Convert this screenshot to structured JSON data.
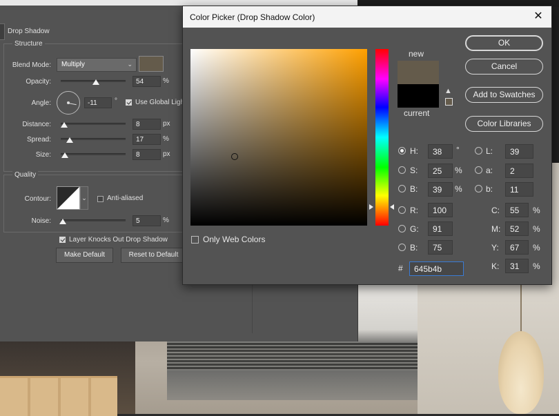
{
  "layer_style": {
    "section_title": "Drop Shadow",
    "structure": {
      "group_label": "Structure",
      "blend_mode_label": "Blend Mode:",
      "blend_mode_value": "Multiply",
      "shadow_color": "#645b4b",
      "opacity_label": "Opacity:",
      "opacity_value": "54",
      "opacity_fraction": 0.54,
      "opacity_unit": "%",
      "angle_label": "Angle:",
      "angle_value": "-11",
      "angle_unit": "°",
      "use_global_light_label": "Use Global Ligh",
      "use_global_light_checked": true,
      "distance_label": "Distance:",
      "distance_value": "8",
      "distance_unit": "px",
      "spread_label": "Spread:",
      "spread_value": "17",
      "spread_unit": "%",
      "size_label": "Size:",
      "size_value": "8",
      "size_unit": "px"
    },
    "quality": {
      "group_label": "Quality",
      "contour_label": "Contour:",
      "anti_aliased_label": "Anti-aliased",
      "anti_aliased_checked": false,
      "noise_label": "Noise:",
      "noise_value": "5",
      "noise_unit": "%"
    },
    "layer_knocks_out_label": "Layer Knocks Out Drop Shadow",
    "layer_knocks_out_checked": true,
    "make_default_label": "Make Default",
    "reset_default_label": "Reset to Default"
  },
  "color_picker": {
    "title": "Color Picker (Drop Shadow Color)",
    "new_label": "new",
    "current_label": "current",
    "new_color": "#645b4b",
    "current_color": "#000000",
    "buttons": {
      "ok": "OK",
      "cancel": "Cancel",
      "add_to_swatches": "Add to Swatches",
      "color_libraries": "Color Libraries"
    },
    "only_web_colors_label": "Only Web Colors",
    "hsb": [
      {
        "label": "H:",
        "value": "38",
        "unit": "°",
        "selected": true
      },
      {
        "label": "S:",
        "value": "25",
        "unit": "%",
        "selected": false
      },
      {
        "label": "B:",
        "value": "39",
        "unit": "%",
        "selected": false
      }
    ],
    "rgb": [
      {
        "label": "R:",
        "value": "100"
      },
      {
        "label": "G:",
        "value": "91"
      },
      {
        "label": "B:",
        "value": "75"
      }
    ],
    "lab": [
      {
        "label": "L:",
        "value": "39"
      },
      {
        "label": "a:",
        "value": "2"
      },
      {
        "label": "b:",
        "value": "11"
      }
    ],
    "cmyk": [
      {
        "label": "C:",
        "value": "55",
        "unit": "%"
      },
      {
        "label": "M:",
        "value": "52",
        "unit": "%"
      },
      {
        "label": "Y:",
        "value": "67",
        "unit": "%"
      },
      {
        "label": "K:",
        "value": "31",
        "unit": "%"
      }
    ],
    "hex_label": "#",
    "hex_value": "645b4b"
  }
}
